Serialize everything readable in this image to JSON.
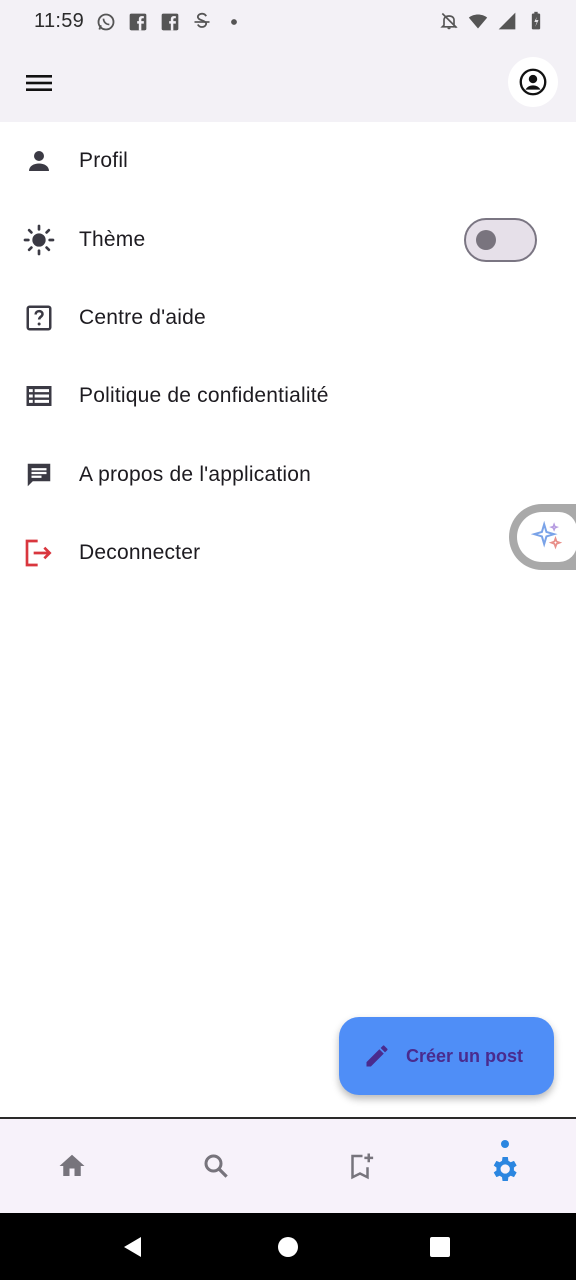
{
  "status_bar": {
    "time": "11:59",
    "left_icons": [
      "whatsapp-icon",
      "facebook-icon",
      "facebook-icon",
      "app-icon",
      "dot-icon"
    ],
    "right_icons": [
      "notifications-off-icon",
      "wifi-icon",
      "signal-icon",
      "battery-icon"
    ]
  },
  "app_bar": {
    "menu_icon": "menu-icon",
    "account_icon": "account-circle-icon"
  },
  "settings": {
    "items": [
      {
        "label": "Profil",
        "icon": "person-icon"
      },
      {
        "label": "Thème",
        "icon": "brightness-icon",
        "toggle": false
      },
      {
        "label": "Centre d'aide",
        "icon": "help-icon"
      },
      {
        "label": "Politique de confidentialité",
        "icon": "list-icon"
      },
      {
        "label": "A propos de l'application",
        "icon": "chat-icon"
      },
      {
        "label": "Deconnecter",
        "icon": "logout-icon"
      }
    ]
  },
  "fab": {
    "label": "Créer un post",
    "icon": "edit-icon"
  },
  "bottom_nav": {
    "items": [
      "home-icon",
      "search-icon",
      "bookmark-add-icon",
      "settings-icon"
    ],
    "active_index": 3
  },
  "colors": {
    "appbar_bg": "#f3f1f6",
    "fab_bg": "#4f8ef7",
    "fab_text": "#4a2b8e",
    "active_nav": "#2b86e0",
    "logout_red": "#d9363e",
    "icon_dark": "#3b3a44"
  }
}
